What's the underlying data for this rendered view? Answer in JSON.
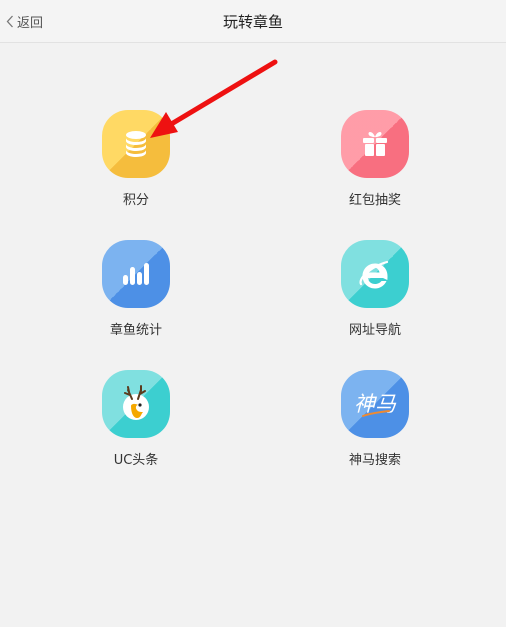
{
  "header": {
    "back_label": "返回",
    "title": "玩转章鱼"
  },
  "tiles": [
    {
      "label": "积分",
      "icon": "coins-icon",
      "color_a": "#ffd44f",
      "color_b": "#f5bd3d"
    },
    {
      "label": "红包抽奖",
      "icon": "gift-icon",
      "color_a": "#ff8f9c",
      "color_b": "#f86f80"
    },
    {
      "label": "章鱼统计",
      "icon": "bar-chart-icon",
      "color_a": "#6aa9ee",
      "color_b": "#4d90e6"
    },
    {
      "label": "网址导航",
      "icon": "ie-browser-icon",
      "color_a": "#6fdcdc",
      "color_b": "#3ccfd0"
    },
    {
      "label": "UC头条",
      "icon": "uc-headline-icon",
      "color_a": "#6fdcdc",
      "color_b": "#3ccfd0"
    },
    {
      "label": "神马搜索",
      "icon": "shenma-search-icon",
      "color_a": "#6aa9ee",
      "color_b": "#4d90e6",
      "logo_text": "神马"
    }
  ],
  "annotation": {
    "arrow_color": "#ee1111"
  }
}
